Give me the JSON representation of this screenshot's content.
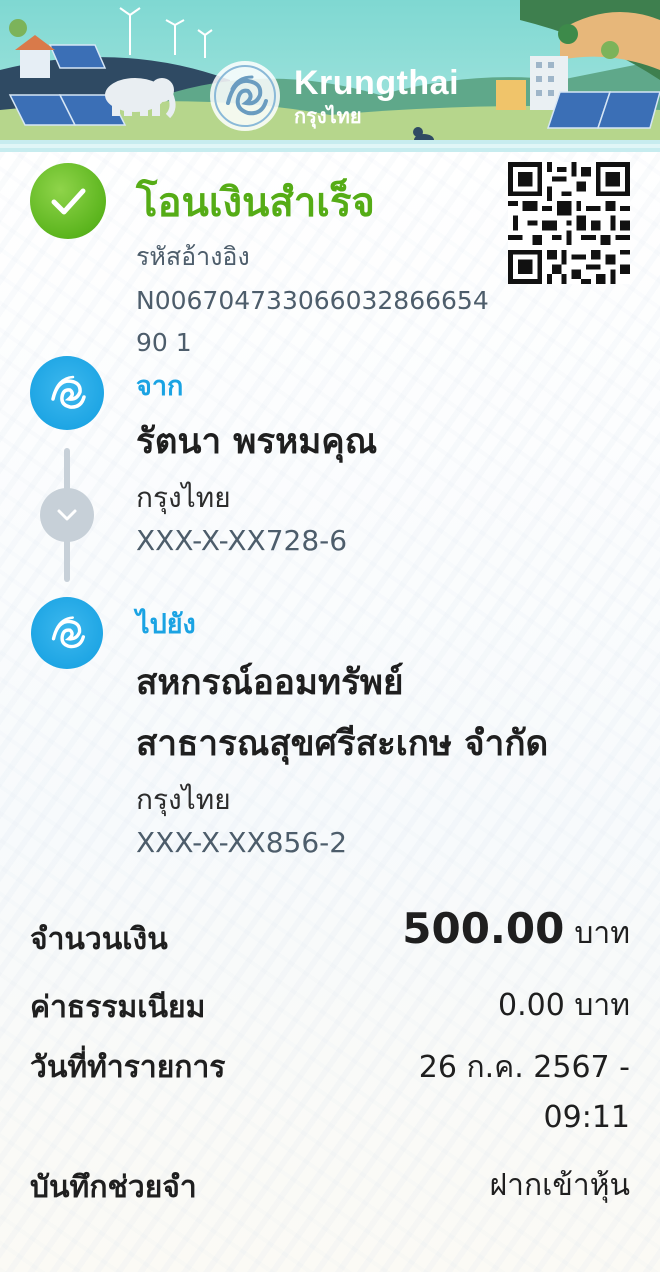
{
  "brand": {
    "name_en": "Krungthai",
    "name_th": "กรุงไทย"
  },
  "status": {
    "title": "โอนเงินสำเร็จ",
    "ref_label": "รหัสอ้างอิง",
    "ref_value": "N00670473306603286665490 1"
  },
  "from": {
    "label": "จาก",
    "name": "รัตนา พรหมคุณ",
    "bank": "กรุงไทย",
    "account": "XXX-X-XX728-6"
  },
  "to": {
    "label": "ไปยัง",
    "name_line1": "สหกรณ์ออมทรัพย์",
    "name_line2": "สาธารณสุขศรีสะเกษ จำกัด",
    "bank": "กรุงไทย",
    "account": "XXX-X-XX856-2"
  },
  "details": {
    "amount_label": "จำนวนเงิน",
    "amount_value": "500.00",
    "amount_unit": "บาท",
    "fee_label": "ค่าธรรมเนียม",
    "fee_value": "0.00 บาท",
    "date_label": "วันที่ทำรายการ",
    "date_value_line1": "26 ก.ค. 2567 -",
    "date_value_line2": "09:11",
    "memo_label": "บันทึกช่วยจำ",
    "memo_value": "ฝากเข้าหุ้น"
  },
  "colors": {
    "success_green": "#55ac16",
    "brand_blue": "#1aa3e3",
    "muted_text": "#4d5d6b",
    "connector_grey": "#c7d0d8"
  },
  "icons": {
    "success": "check-circle-icon",
    "avatar": "krungthai-bird-icon",
    "down": "chevron-down-icon",
    "qr": "qr-code-icon"
  }
}
